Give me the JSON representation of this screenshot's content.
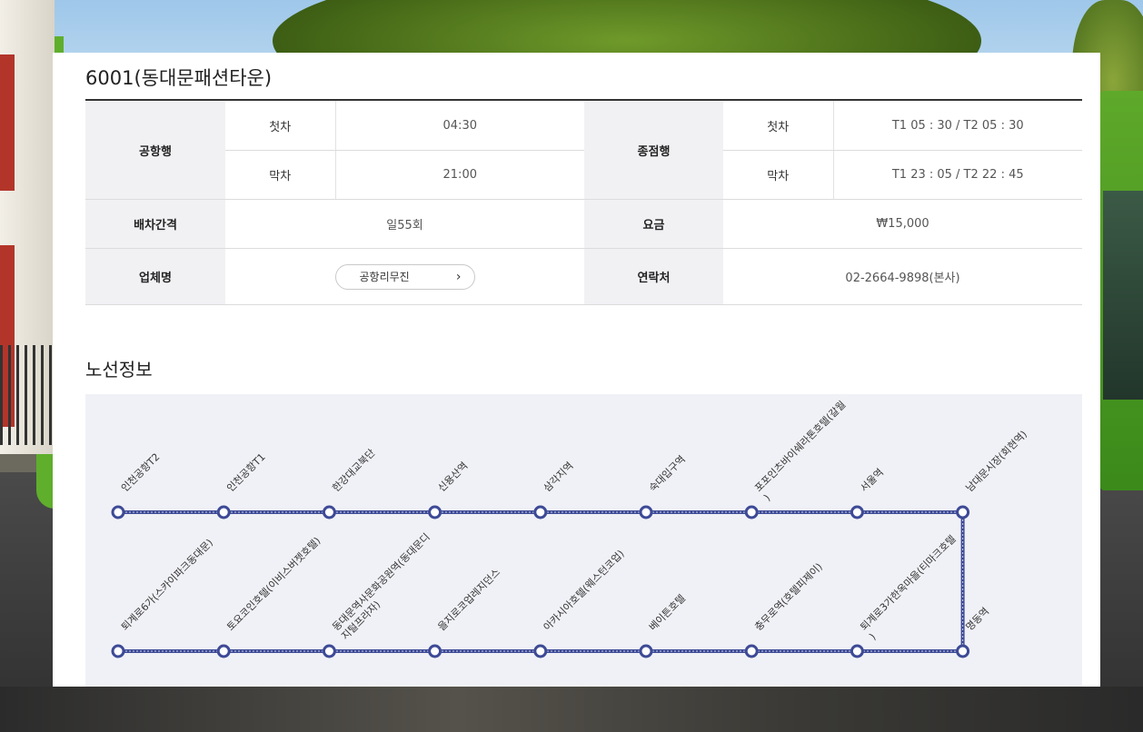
{
  "route": {
    "title": "6001(동대문패션타운)"
  },
  "schedule": {
    "airbound_label": "공항행",
    "terminalbound_label": "종점행",
    "first_label": "첫차",
    "last_label": "막차",
    "airbound_first": "04:30",
    "airbound_last": "21:00",
    "terminalbound_first": "T1 05 : 30 / T2 05 : 30",
    "terminalbound_last": "T1 23 : 05 / T2 22 : 45"
  },
  "details": {
    "interval_label": "배차간격",
    "interval_value": "일55회",
    "fare_label": "요금",
    "fare_value": "₩15,000",
    "company_label": "업체명",
    "company_button": "공항리무진",
    "contact_label": "연락처",
    "contact_value": "02-2664-9898(본사)"
  },
  "route_info": {
    "section_title": "노선정보",
    "top_row": [
      {
        "name": "인천공항T2"
      },
      {
        "name": "인천공항T1"
      },
      {
        "name": "한강대교북단"
      },
      {
        "name": "신용산역"
      },
      {
        "name": "삼각지역"
      },
      {
        "name": "숙대입구역"
      },
      {
        "name": "포포인츠바이쉐라톤호텔(갈월",
        "wrap": ")"
      },
      {
        "name": "서울역"
      },
      {
        "name": "남대문시장(회현역)"
      }
    ],
    "bottom_row": [
      {
        "name": "퇴계로6가(스카이파크동대문)"
      },
      {
        "name": "토요코인호텔(이비스버젯호텔)"
      },
      {
        "name": "동대문역사문화공원역(동대문디",
        "wrap": "지털프라자)"
      },
      {
        "name": "을지로코업레지던스"
      },
      {
        "name": "아카시아호텔(웨스턴코업)"
      },
      {
        "name": "베이튼호텔"
      },
      {
        "name": "충무로역(호텔피제이)"
      },
      {
        "name": "퇴계로3가한옥마을(티마크호텔",
        "wrap": ")"
      },
      {
        "name": "명동역"
      }
    ],
    "line_color": "#3d4a96"
  }
}
